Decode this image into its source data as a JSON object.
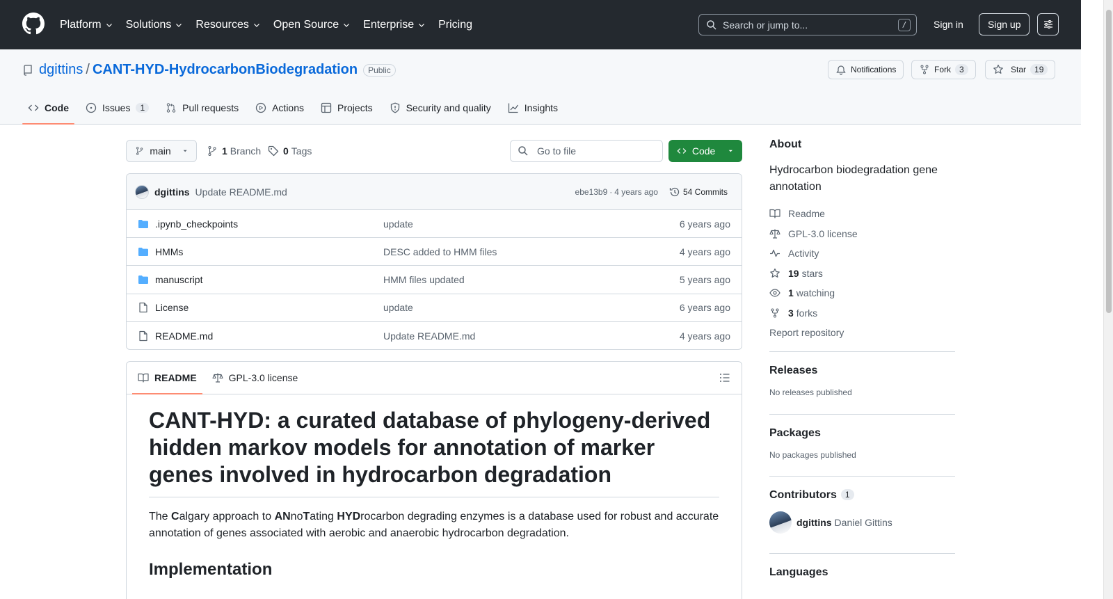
{
  "header": {
    "nav": [
      "Platform",
      "Solutions",
      "Resources",
      "Open Source",
      "Enterprise",
      "Pricing"
    ],
    "search_placeholder": "Search or jump to...",
    "search_shortcut": "/",
    "sign_in": "Sign in",
    "sign_up": "Sign up"
  },
  "repo": {
    "owner": "dgittins",
    "separator": "/",
    "name": "CANT-HYD-HydrocarbonBiodegradation",
    "visibility": "Public",
    "notifications_label": "Notifications",
    "fork_label": "Fork",
    "fork_count": "3",
    "star_label": "Star",
    "star_count": "19"
  },
  "tabs": [
    {
      "label": "Code",
      "icon": "code-icon",
      "active": true
    },
    {
      "label": "Issues",
      "icon": "issue-opened-icon",
      "count": "1"
    },
    {
      "label": "Pull requests",
      "icon": "git-pull-request-icon"
    },
    {
      "label": "Actions",
      "icon": "play-icon"
    },
    {
      "label": "Projects",
      "icon": "table-icon"
    },
    {
      "label": "Security and quality",
      "icon": "shield-icon"
    },
    {
      "label": "Insights",
      "icon": "graph-icon"
    }
  ],
  "toolbar": {
    "branch": "main",
    "branches_count": "1",
    "branches_label": "Branch",
    "tags_count": "0",
    "tags_label": "Tags",
    "go_to_file": "Go to file",
    "code_button": "Code"
  },
  "latest_commit": {
    "author": "dgittins",
    "message": "Update README.md",
    "hash": "ebe13b9",
    "dot": "·",
    "age": "4 years ago",
    "commits_label": "54 Commits"
  },
  "files": [
    {
      "type": "folder",
      "name": ".ipynb_checkpoints",
      "message": "update",
      "date": "6 years ago"
    },
    {
      "type": "folder",
      "name": "HMMs",
      "message": "DESC added to HMM files",
      "date": "4 years ago"
    },
    {
      "type": "folder",
      "name": "manuscript",
      "message": "HMM files updated",
      "date": "5 years ago"
    },
    {
      "type": "file",
      "name": "License",
      "message": "update",
      "date": "6 years ago"
    },
    {
      "type": "file",
      "name": "README.md",
      "message": "Update README.md",
      "date": "4 years ago"
    }
  ],
  "readme": {
    "tab_readme": "README",
    "tab_license": "GPL-3.0 license",
    "title": "CANT-HYD: a curated database of phylogeny-derived hidden markov models for annotation of marker genes involved in hydrocarbon degradation",
    "intro": {
      "t1": "The ",
      "b1": "C",
      "t2": "algary approach to ",
      "b2": "AN",
      "t3": "no",
      "b3": "T",
      "t4": "ating ",
      "b4": "HYD",
      "t5": "rocarbon degrading enzymes is a database used for robust and accurate annotation of genes associated with aerobic and anaerobic hydrocarbon degradation."
    },
    "section_heading": "Implementation"
  },
  "sidebar": {
    "about_heading": "About",
    "description": "Hydrocarbon biodegradation gene annotation",
    "readme": "Readme",
    "license": "GPL-3.0 license",
    "activity": "Activity",
    "stars_count": "19",
    "stars_label": "stars",
    "watching_count": "1",
    "watching_label": "watching",
    "forks_count": "3",
    "forks_label": "forks",
    "report": "Report repository",
    "releases_heading": "Releases",
    "releases_text": "No releases published",
    "packages_heading": "Packages",
    "packages_text": "No packages published",
    "contributors_heading": "Contributors",
    "contributors_count": "1",
    "contributor_login": "dgittins",
    "contributor_name": "Daniel Gittins",
    "languages_heading": "Languages"
  },
  "colors": {
    "header_bg": "#24292f",
    "link": "#0969da",
    "code_button": "#1f883d",
    "tab_underline": "#fd8c73",
    "folder": "#54aeff"
  }
}
